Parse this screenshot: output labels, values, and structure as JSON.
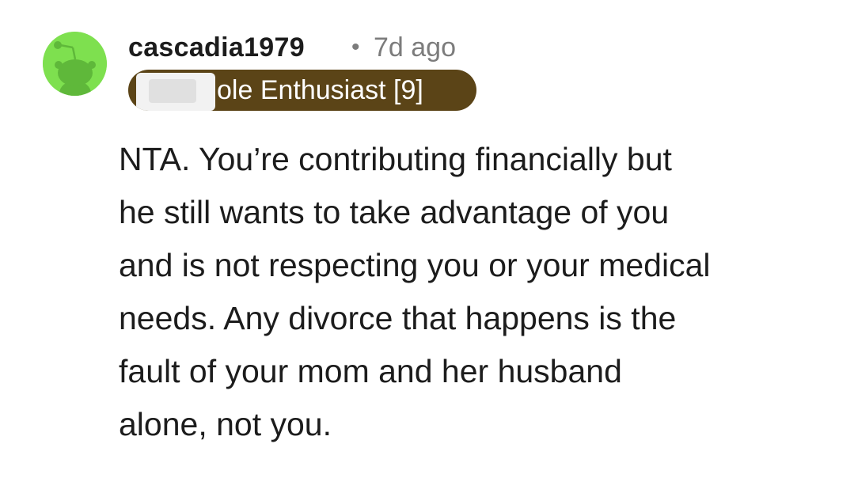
{
  "comment": {
    "avatar": {
      "icon": "snoo-avatar-icon",
      "background": "#7ee04f"
    },
    "username": "cascadia1979",
    "separator": "•",
    "timestamp": "7d ago",
    "flair": {
      "text": "ole Enthusiast [9]",
      "background": "#5b4417",
      "partially_obscured": true
    },
    "body_lines": [
      "NTA. You’re contributing financially but",
      "he still wants to take advantage of you",
      "and is not respecting you or your medical",
      "needs. Any divorce that happens is the",
      "fault of your mom and her husband",
      "alone, not you."
    ]
  }
}
